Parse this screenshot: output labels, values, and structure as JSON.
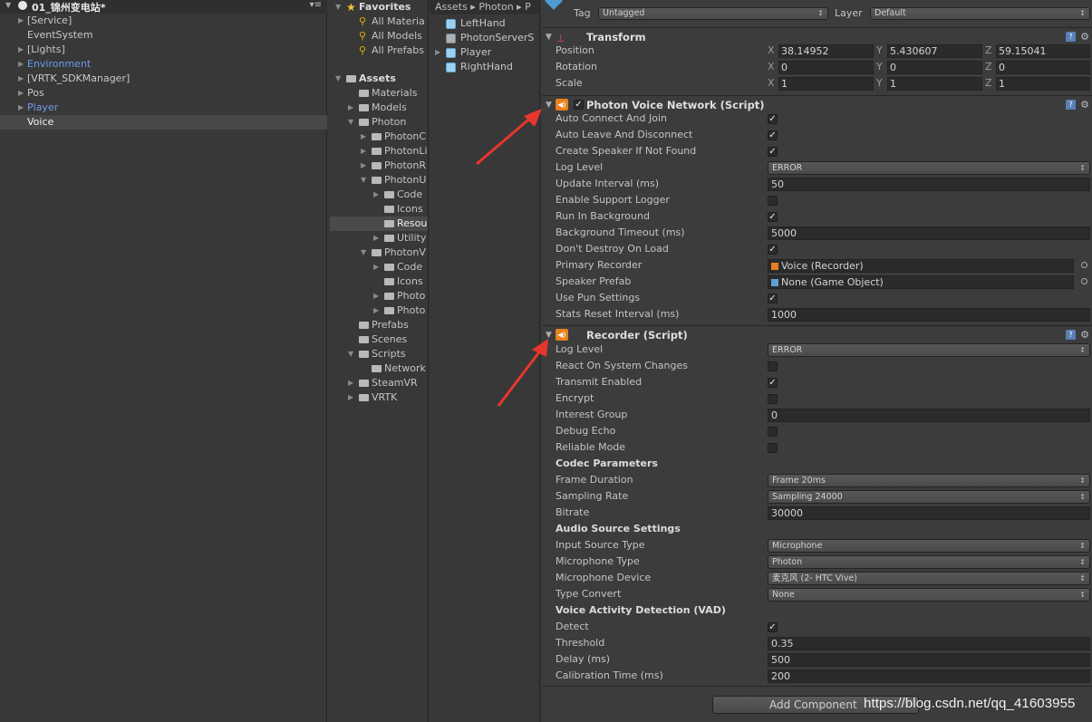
{
  "hierarchy": {
    "scene_name": "01_锦州变电站*",
    "items": [
      {
        "label": "[Service]",
        "expandable": true
      },
      {
        "label": "EventSystem",
        "expandable": false
      },
      {
        "label": "[Lights]",
        "expandable": true
      },
      {
        "label": "Environment",
        "expandable": true,
        "prefab": true
      },
      {
        "label": "[VRTK_SDKManager]",
        "expandable": true
      },
      {
        "label": "Pos",
        "expandable": true
      },
      {
        "label": "Player",
        "expandable": true,
        "prefab": true
      },
      {
        "label": "Voice",
        "expandable": false,
        "selected": true
      }
    ]
  },
  "project": {
    "items": [
      {
        "label": "Favorites",
        "icon": "star",
        "depth": 0,
        "arrow": "down",
        "bold": true
      },
      {
        "label": "All Materia",
        "icon": "search",
        "depth": 1
      },
      {
        "label": "All Models",
        "icon": "search",
        "depth": 1
      },
      {
        "label": "All Prefabs",
        "icon": "search",
        "depth": 1
      },
      {
        "label": "Assets",
        "icon": "folder",
        "depth": 0,
        "arrow": "down",
        "bold": true
      },
      {
        "label": "Materials",
        "icon": "folder",
        "depth": 1
      },
      {
        "label": "Models",
        "icon": "folder",
        "depth": 1,
        "arrow": "right"
      },
      {
        "label": "Photon",
        "icon": "folder",
        "depth": 1,
        "arrow": "down"
      },
      {
        "label": "PhotonC",
        "icon": "folder",
        "depth": 2,
        "arrow": "right"
      },
      {
        "label": "PhotonLi",
        "icon": "folder",
        "depth": 2,
        "arrow": "right"
      },
      {
        "label": "PhotonR",
        "icon": "folder",
        "depth": 2,
        "arrow": "right"
      },
      {
        "label": "PhotonU",
        "icon": "folder",
        "depth": 2,
        "arrow": "down"
      },
      {
        "label": "Code",
        "icon": "folder",
        "depth": 3,
        "arrow": "right"
      },
      {
        "label": "Icons",
        "icon": "folder",
        "depth": 3
      },
      {
        "label": "Resou",
        "icon": "folder",
        "depth": 3,
        "selected": true
      },
      {
        "label": "Utility",
        "icon": "folder",
        "depth": 3,
        "arrow": "right"
      },
      {
        "label": "PhotonV",
        "icon": "folder",
        "depth": 2,
        "arrow": "down"
      },
      {
        "label": "Code",
        "icon": "folder",
        "depth": 3,
        "arrow": "right"
      },
      {
        "label": "Icons",
        "icon": "folder",
        "depth": 3
      },
      {
        "label": "Photo",
        "icon": "folder",
        "depth": 3,
        "arrow": "right"
      },
      {
        "label": "Photo",
        "icon": "folder",
        "depth": 3,
        "arrow": "right"
      },
      {
        "label": "Prefabs",
        "icon": "folder",
        "depth": 1
      },
      {
        "label": "Scenes",
        "icon": "folder",
        "depth": 1
      },
      {
        "label": "Scripts",
        "icon": "folder",
        "depth": 1,
        "arrow": "down"
      },
      {
        "label": "Network",
        "icon": "folder",
        "depth": 2
      },
      {
        "label": "SteamVR",
        "icon": "folder",
        "depth": 1,
        "arrow": "right"
      },
      {
        "label": "VRTK",
        "icon": "folder",
        "depth": 1,
        "arrow": "right"
      }
    ]
  },
  "assets": {
    "breadcrumb": "Assets ▸ Photon ▸ P",
    "items": [
      {
        "label": "LeftHand",
        "icon": "prefab",
        "arrow": false
      },
      {
        "label": "PhotonServerS",
        "icon": "asset",
        "arrow": false
      },
      {
        "label": "Player",
        "icon": "prefab",
        "arrow": true
      },
      {
        "label": "RightHand",
        "icon": "prefab",
        "arrow": false
      }
    ]
  },
  "inspector": {
    "tag_label": "Tag",
    "tag_value": "Untagged",
    "layer_label": "Layer",
    "layer_value": "Default",
    "transform": {
      "title": "Transform",
      "rows": [
        {
          "label": "Position",
          "x": "38.14952",
          "y": "5.430607",
          "z": "59.15041"
        },
        {
          "label": "Rotation",
          "x": "0",
          "y": "0",
          "z": "0"
        },
        {
          "label": "Scale",
          "x": "1",
          "y": "1",
          "z": "1"
        }
      ]
    },
    "voice_network": {
      "title": "Photon Voice Network (Script)",
      "rows": [
        {
          "label": "Auto Connect And Join",
          "type": "check",
          "value": true
        },
        {
          "label": "Auto Leave And Disconnect",
          "type": "check",
          "value": true
        },
        {
          "label": "Create Speaker If Not Found",
          "type": "check",
          "value": true
        },
        {
          "label": "Log Level",
          "type": "drop",
          "value": "ERROR"
        },
        {
          "label": "Update Interval (ms)",
          "type": "field",
          "value": "50"
        },
        {
          "label": "Enable Support Logger",
          "type": "check",
          "value": false
        },
        {
          "label": "Run In Background",
          "type": "check",
          "value": true
        },
        {
          "label": "Background Timeout (ms)",
          "type": "field",
          "value": "5000"
        },
        {
          "label": "Don't Destroy On Load",
          "type": "check",
          "value": true
        },
        {
          "label": "Primary Recorder",
          "type": "object",
          "value": "Voice (Recorder)",
          "icon": "recorder"
        },
        {
          "label": "Speaker Prefab",
          "type": "object",
          "value": "None (Game Object)",
          "icon": "gameobject"
        },
        {
          "label": "Use Pun Settings",
          "type": "check",
          "value": true
        },
        {
          "label": "Stats Reset Interval (ms)",
          "type": "field",
          "value": "1000"
        }
      ]
    },
    "recorder": {
      "title": "Recorder (Script)",
      "rows": [
        {
          "label": "Log Level",
          "type": "drop",
          "value": "ERROR"
        },
        {
          "label": "React On System Changes",
          "type": "check",
          "value": false
        },
        {
          "label": "Transmit Enabled",
          "type": "check",
          "value": true
        },
        {
          "label": "Encrypt",
          "type": "check",
          "value": false
        },
        {
          "label": "Interest Group",
          "type": "field",
          "value": "0"
        },
        {
          "label": "Debug Echo",
          "type": "check",
          "value": false
        },
        {
          "label": "Reliable Mode",
          "type": "check",
          "value": false
        },
        {
          "label": "Codec Parameters",
          "type": "header"
        },
        {
          "label": "Frame Duration",
          "type": "drop",
          "value": "Frame 20ms"
        },
        {
          "label": "Sampling Rate",
          "type": "drop",
          "value": "Sampling 24000"
        },
        {
          "label": "Bitrate",
          "type": "field",
          "value": "30000"
        },
        {
          "label": "Audio Source Settings",
          "type": "header"
        },
        {
          "label": "Input Source Type",
          "type": "drop",
          "value": "Microphone"
        },
        {
          "label": "Microphone Type",
          "type": "drop",
          "value": "Photon"
        },
        {
          "label": "Microphone Device",
          "type": "drop",
          "value": "麦克风 (2- HTC Vive)"
        },
        {
          "label": "Type Convert",
          "type": "drop",
          "value": "None"
        },
        {
          "label": "Voice Activity Detection (VAD)",
          "type": "header"
        },
        {
          "label": "Detect",
          "type": "check",
          "value": true
        },
        {
          "label": "Threshold",
          "type": "field",
          "value": "0.35"
        },
        {
          "label": "Delay (ms)",
          "type": "field",
          "value": "500"
        },
        {
          "label": "Calibration Time (ms)",
          "type": "field",
          "value": "200"
        }
      ]
    },
    "add_component_label": "Add Component",
    "watermark": "https://blog.csdn.net/qq_41603955"
  },
  "colors": {
    "panel_bg": "#383838",
    "inspector_bg": "#3c3c3c",
    "prefab_text": "#6f9be9",
    "arrow_red": "#e8362d",
    "component_icon": "#e8801d"
  }
}
